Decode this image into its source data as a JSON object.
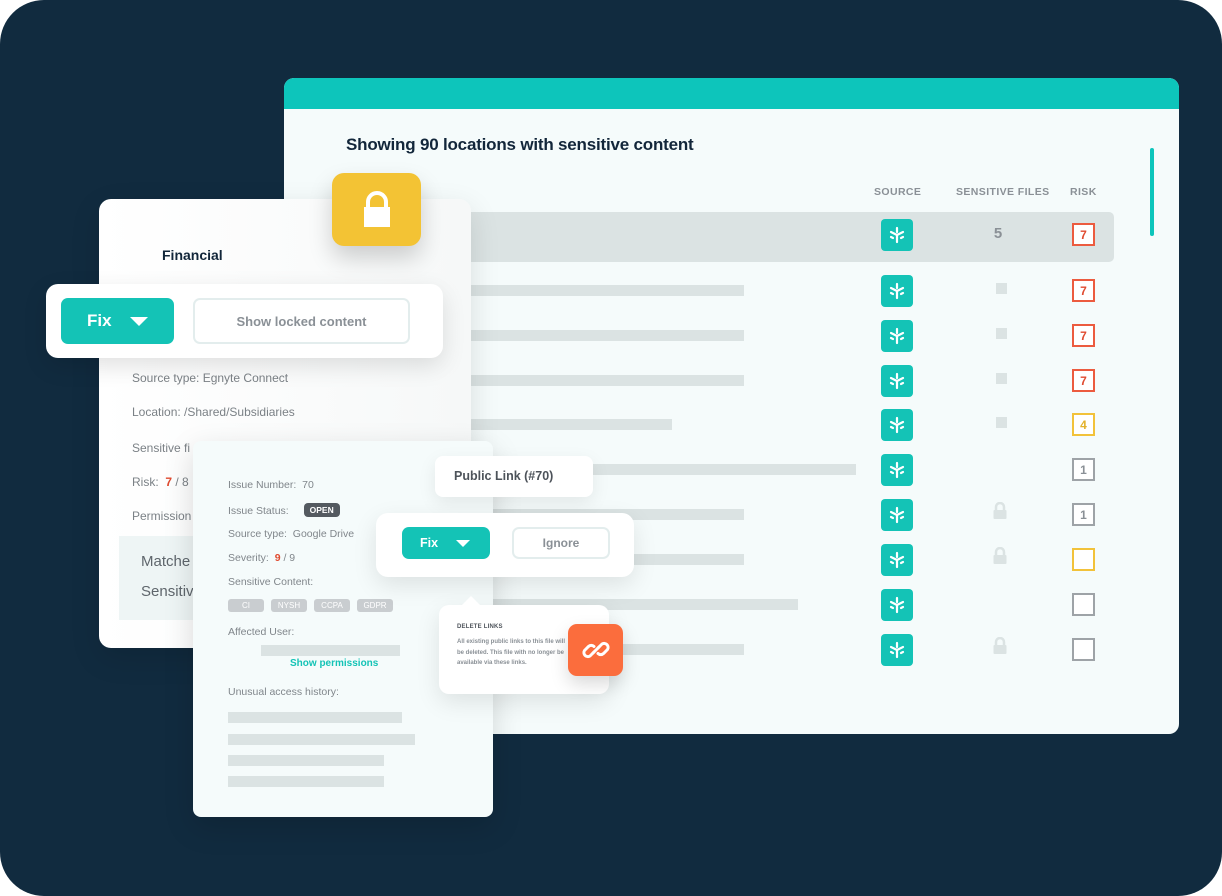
{
  "colors": {
    "background": "#112b3f",
    "accent": "#0dc5bb",
    "risk_high": "#ec5b3f",
    "risk_medium": "#f2c23a",
    "risk_low": "#9ea3a7",
    "lock_tile": "#f3c334",
    "link_tile": "#fb6d3d"
  },
  "main": {
    "title": "Showing 90 locations with sensitive content",
    "columns": {
      "source": "SOURCE",
      "sensitive_files": "SENSITIVE FILES",
      "risk": "RISK"
    },
    "rows": [
      {
        "selected": true,
        "source_icon": "egnyte-icon",
        "sensitive_files": "5",
        "files_marker": "number",
        "risk": "7",
        "risk_level": "high"
      },
      {
        "selected": false,
        "source_icon": "egnyte-icon",
        "sensitive_files": "",
        "files_marker": "square",
        "risk": "7",
        "risk_level": "high"
      },
      {
        "selected": false,
        "source_icon": "egnyte-icon",
        "sensitive_files": "",
        "files_marker": "square",
        "risk": "7",
        "risk_level": "high"
      },
      {
        "selected": false,
        "source_icon": "egnyte-icon",
        "sensitive_files": "",
        "files_marker": "square",
        "risk": "7",
        "risk_level": "high"
      },
      {
        "selected": false,
        "source_icon": "egnyte-icon",
        "sensitive_files": "",
        "files_marker": "square",
        "risk": "4",
        "risk_level": "medium"
      },
      {
        "selected": false,
        "source_icon": "egnyte-icon",
        "sensitive_files": "",
        "files_marker": "none",
        "risk": "1",
        "risk_level": "low"
      },
      {
        "selected": false,
        "source_icon": "egnyte-icon",
        "sensitive_files": "",
        "files_marker": "lock",
        "risk": "1",
        "risk_level": "low"
      },
      {
        "selected": false,
        "source_icon": "egnyte-icon",
        "sensitive_files": "",
        "files_marker": "lock",
        "risk": "",
        "risk_level": "medium"
      },
      {
        "selected": false,
        "source_icon": "egnyte-icon",
        "sensitive_files": "",
        "files_marker": "none",
        "risk": "",
        "risk_level": "low"
      },
      {
        "selected": false,
        "source_icon": "egnyte-icon",
        "sensitive_files": "",
        "files_marker": "lock",
        "risk": "",
        "risk_level": "low"
      }
    ]
  },
  "location_card": {
    "title": "Financial",
    "fix_label": "Fix",
    "show_locked_label": "Show locked content",
    "source_type": "Source type: Egnyte Connect",
    "location": "Location: /Shared/Subsidiaries",
    "sensitive_files_label": "Sensitive fi",
    "risk_label": "Risk:",
    "risk_value": "7",
    "risk_max": "/ 8",
    "permissions_label": "Permission",
    "matches_label": "Matche",
    "sensitive_label": "Sensitiv"
  },
  "issue_card": {
    "issue_number_label": "Issue Number:",
    "issue_number": "70",
    "issue_status_label": "Issue Status:",
    "issue_status": "OPEN",
    "source_type_label": "Source type:",
    "source_type": "Google Drive",
    "severity_label": "Severity:",
    "severity_value": "9",
    "severity_max": "/ 9",
    "sensitive_content_label": "Sensitive Content:",
    "tags": [
      "CI",
      "NYSH",
      "CCPA",
      "GDPR"
    ],
    "affected_user_label": "Affected User:",
    "show_permissions": "Show permissions",
    "unusual_access_label": "Unusual access history:"
  },
  "public_link": {
    "title": "Public Link (#70)",
    "fix_label": "Fix",
    "ignore_label": "Ignore",
    "tooltip_title": "DELETE LINKS",
    "tooltip_body": "All existing public links to this file will be deleted. This file with no longer be available via these links."
  }
}
